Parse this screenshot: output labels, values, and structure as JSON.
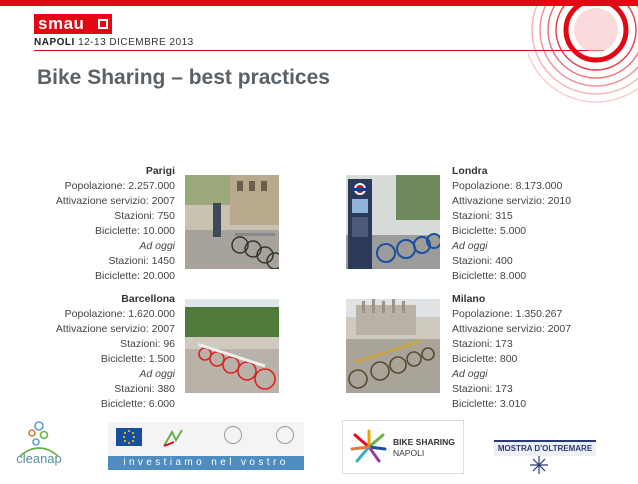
{
  "header": {
    "logo_text": "smau",
    "event_city": "NAPOLI",
    "event_dates": "12-13 DICEMBRE 2013"
  },
  "slide": {
    "title": "Bike Sharing – best practices"
  },
  "cities": {
    "parigi": {
      "name": "Parigi",
      "lines": [
        "Popolazione: 2.257.000",
        "Attivazione servizio: 2007",
        "Stazioni: 750",
        "Biciclette: 10.000"
      ],
      "today_label": "Ad oggi",
      "today_lines": [
        "Stazioni: 1450",
        "Biciclette: 20.000"
      ]
    },
    "londra": {
      "name": "Londra",
      "lines": [
        "Popolazione: 8.173.000",
        "Attivazione servizio: 2010",
        "Stazioni: 315",
        "Biciclette: 5.000"
      ],
      "today_label": "Ad oggi",
      "today_lines": [
        "Stazioni: 400",
        "Biciclette: 8.000"
      ]
    },
    "barcellona": {
      "name": "Barcellona",
      "lines": [
        "Popolazione: 1.620.000",
        "Attivazione servizio: 2007",
        "Stazioni: 96",
        "Biciclette: 1.500"
      ],
      "today_label": "Ad oggi",
      "today_lines": [
        "Stazioni: 380",
        "Biciclette: 6.000"
      ]
    },
    "milano": {
      "name": "Milano",
      "lines": [
        "Popolazione: 1.350.267",
        "Attivazione servizio: 2007",
        "Stazioni: 173",
        "Biciclette: 800"
      ],
      "today_label": "Ad oggi",
      "today_lines": [
        "Stazioni: 173",
        "Biciclette: 3.010"
      ]
    }
  },
  "footer": {
    "cleanap": "cleanap",
    "motto": "investiamo nel vostro futuro",
    "bike_sharing_title": "BIKE SHARING",
    "bike_sharing_city": "NAPOLI",
    "mostra": "MOSTRA D'OLTREMARE"
  },
  "colors": {
    "brand_red": "#e30613",
    "title_gray": "#5a6268"
  }
}
